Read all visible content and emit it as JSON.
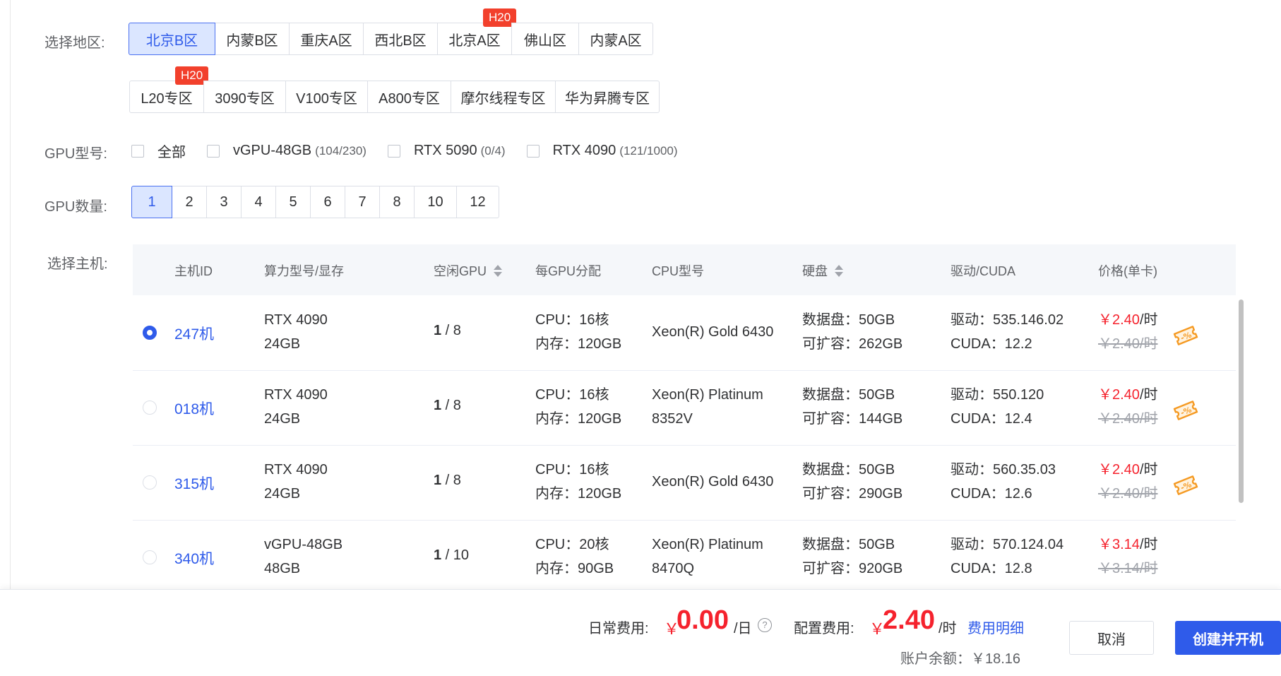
{
  "labels": {
    "region": "选择地区:",
    "gpu_model": "GPU型号:",
    "gpu_count": "GPU数量:",
    "host": "选择主机:"
  },
  "regions_row1": [
    {
      "label": "北京B区",
      "active": true,
      "badge": ""
    },
    {
      "label": "内蒙B区",
      "badge": ""
    },
    {
      "label": "重庆A区",
      "badge": ""
    },
    {
      "label": "西北B区",
      "badge": ""
    },
    {
      "label": "北京A区",
      "badge": "H20"
    },
    {
      "label": "佛山区",
      "badge": ""
    },
    {
      "label": "内蒙A区",
      "badge": ""
    }
  ],
  "regions_row2": [
    {
      "label": "L20专区",
      "badge": "H20"
    },
    {
      "label": "3090专区",
      "badge": ""
    },
    {
      "label": "V100专区",
      "badge": ""
    },
    {
      "label": "A800专区",
      "badge": ""
    },
    {
      "label": "摩尔线程专区",
      "badge": ""
    },
    {
      "label": "华为昇腾专区",
      "badge": ""
    }
  ],
  "gpu_types": [
    {
      "label": "全部",
      "count": ""
    },
    {
      "label": "vGPU-48GB",
      "count": "(104/230)"
    },
    {
      "label": "RTX 5090",
      "count": "(0/4)"
    },
    {
      "label": "RTX 4090",
      "count": "(121/1000)"
    }
  ],
  "gpu_counts": [
    "1",
    "2",
    "3",
    "4",
    "5",
    "6",
    "7",
    "8",
    "10",
    "12"
  ],
  "table": {
    "headers": {
      "host_id": "主机ID",
      "model": "算力型号/显存",
      "idle": "空闲GPU",
      "per_gpu": "每GPU分配",
      "cpu": "CPU型号",
      "disk": "硬盘",
      "driver": "驱动/CUDA",
      "price": "价格(单卡)"
    },
    "rows": [
      {
        "selected": true,
        "id": "247机",
        "model": "RTX 4090",
        "vram": "24GB",
        "idle_free": "1",
        "idle_total": " / 8",
        "cpu_alloc": "CPU：16核",
        "mem_alloc": "内存：120GB",
        "cpu_model": [
          "Xeon(R) Gold 6430"
        ],
        "disk": "数据盘：50GB",
        "expand": "可扩容：262GB",
        "driver": "驱动：535.146.02",
        "cuda": "CUDA：12.2",
        "price": "￥2.40",
        "unit": "/时",
        "old_price": "￥2.40/时",
        "coupon": true
      },
      {
        "selected": false,
        "id": "018机",
        "model": "RTX 4090",
        "vram": "24GB",
        "idle_free": "1",
        "idle_total": " / 8",
        "cpu_alloc": "CPU：16核",
        "mem_alloc": "内存：120GB",
        "cpu_model": [
          "Xeon(R) Platinum",
          "8352V"
        ],
        "disk": "数据盘：50GB",
        "expand": "可扩容：144GB",
        "driver": "驱动：550.120",
        "cuda": "CUDA：12.4",
        "price": "￥2.40",
        "unit": "/时",
        "old_price": "￥2.40/时",
        "coupon": true
      },
      {
        "selected": false,
        "id": "315机",
        "model": "RTX 4090",
        "vram": "24GB",
        "idle_free": "1",
        "idle_total": " / 8",
        "cpu_alloc": "CPU：16核",
        "mem_alloc": "内存：120GB",
        "cpu_model": [
          "Xeon(R) Gold 6430"
        ],
        "disk": "数据盘：50GB",
        "expand": "可扩容：290GB",
        "driver": "驱动：560.35.03",
        "cuda": "CUDA：12.6",
        "price": "￥2.40",
        "unit": "/时",
        "old_price": "￥2.40/时",
        "coupon": true
      },
      {
        "selected": false,
        "id": "340机",
        "model": "vGPU-48GB",
        "vram": "48GB",
        "idle_free": "1",
        "idle_total": " / 10",
        "cpu_alloc": "CPU：20核",
        "mem_alloc": "内存：90GB",
        "cpu_model": [
          "Xeon(R) Platinum",
          "8470Q"
        ],
        "disk": "数据盘：50GB",
        "expand": "可扩容：920GB",
        "driver": "驱动：570.124.04",
        "cuda": "CUDA：12.8",
        "price": "￥3.14",
        "unit": "/时",
        "old_price": "￥3.14/时",
        "coupon": false
      }
    ]
  },
  "footer": {
    "daily_label": "日常费用:",
    "daily_yen": "￥",
    "daily_value": "0.00",
    "daily_unit": "/日",
    "help": "?",
    "config_label": "配置费用:",
    "config_yen": "￥",
    "config_value": "2.40",
    "config_unit": "/时",
    "detail_link": "费用明细",
    "balance": "账户余额：￥18.16",
    "cancel": "取消",
    "create": "创建并开机"
  },
  "colors": {
    "primary": "#2f5bea",
    "price_red": "#f5222d",
    "badge_red": "#f2402c",
    "coupon_orange": "#f59a23"
  }
}
